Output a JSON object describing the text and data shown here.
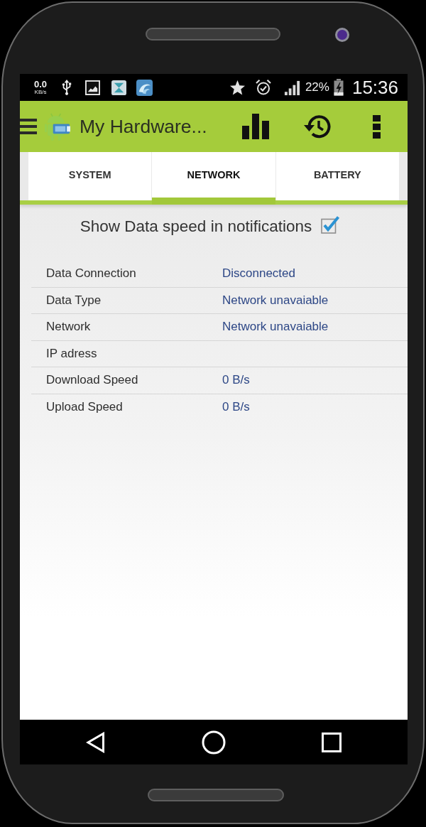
{
  "status_bar": {
    "net_speed": "0.0",
    "net_speed_unit": "KB/s",
    "battery": "22%",
    "time": "15:36"
  },
  "app_bar": {
    "title": "My Hardware..."
  },
  "tabs": [
    {
      "label": "SYSTEM",
      "selected": false
    },
    {
      "label": "NETWORK",
      "selected": true
    },
    {
      "label": "BATTERY",
      "selected": false
    }
  ],
  "notification_toggle": {
    "label": "Show Data speed in notifications",
    "checked": true
  },
  "network_info": [
    {
      "label": "Data Connection",
      "value": "Disconnected"
    },
    {
      "label": "Data Type",
      "value": "Network unavaiable"
    },
    {
      "label": "Network",
      "value": "Network unavaiable"
    },
    {
      "label": "IP adress"
    },
    {
      "label": "Download Speed",
      "value": "0 B/s"
    },
    {
      "label": "Upload Speed",
      "value": "0 B/s"
    }
  ]
}
